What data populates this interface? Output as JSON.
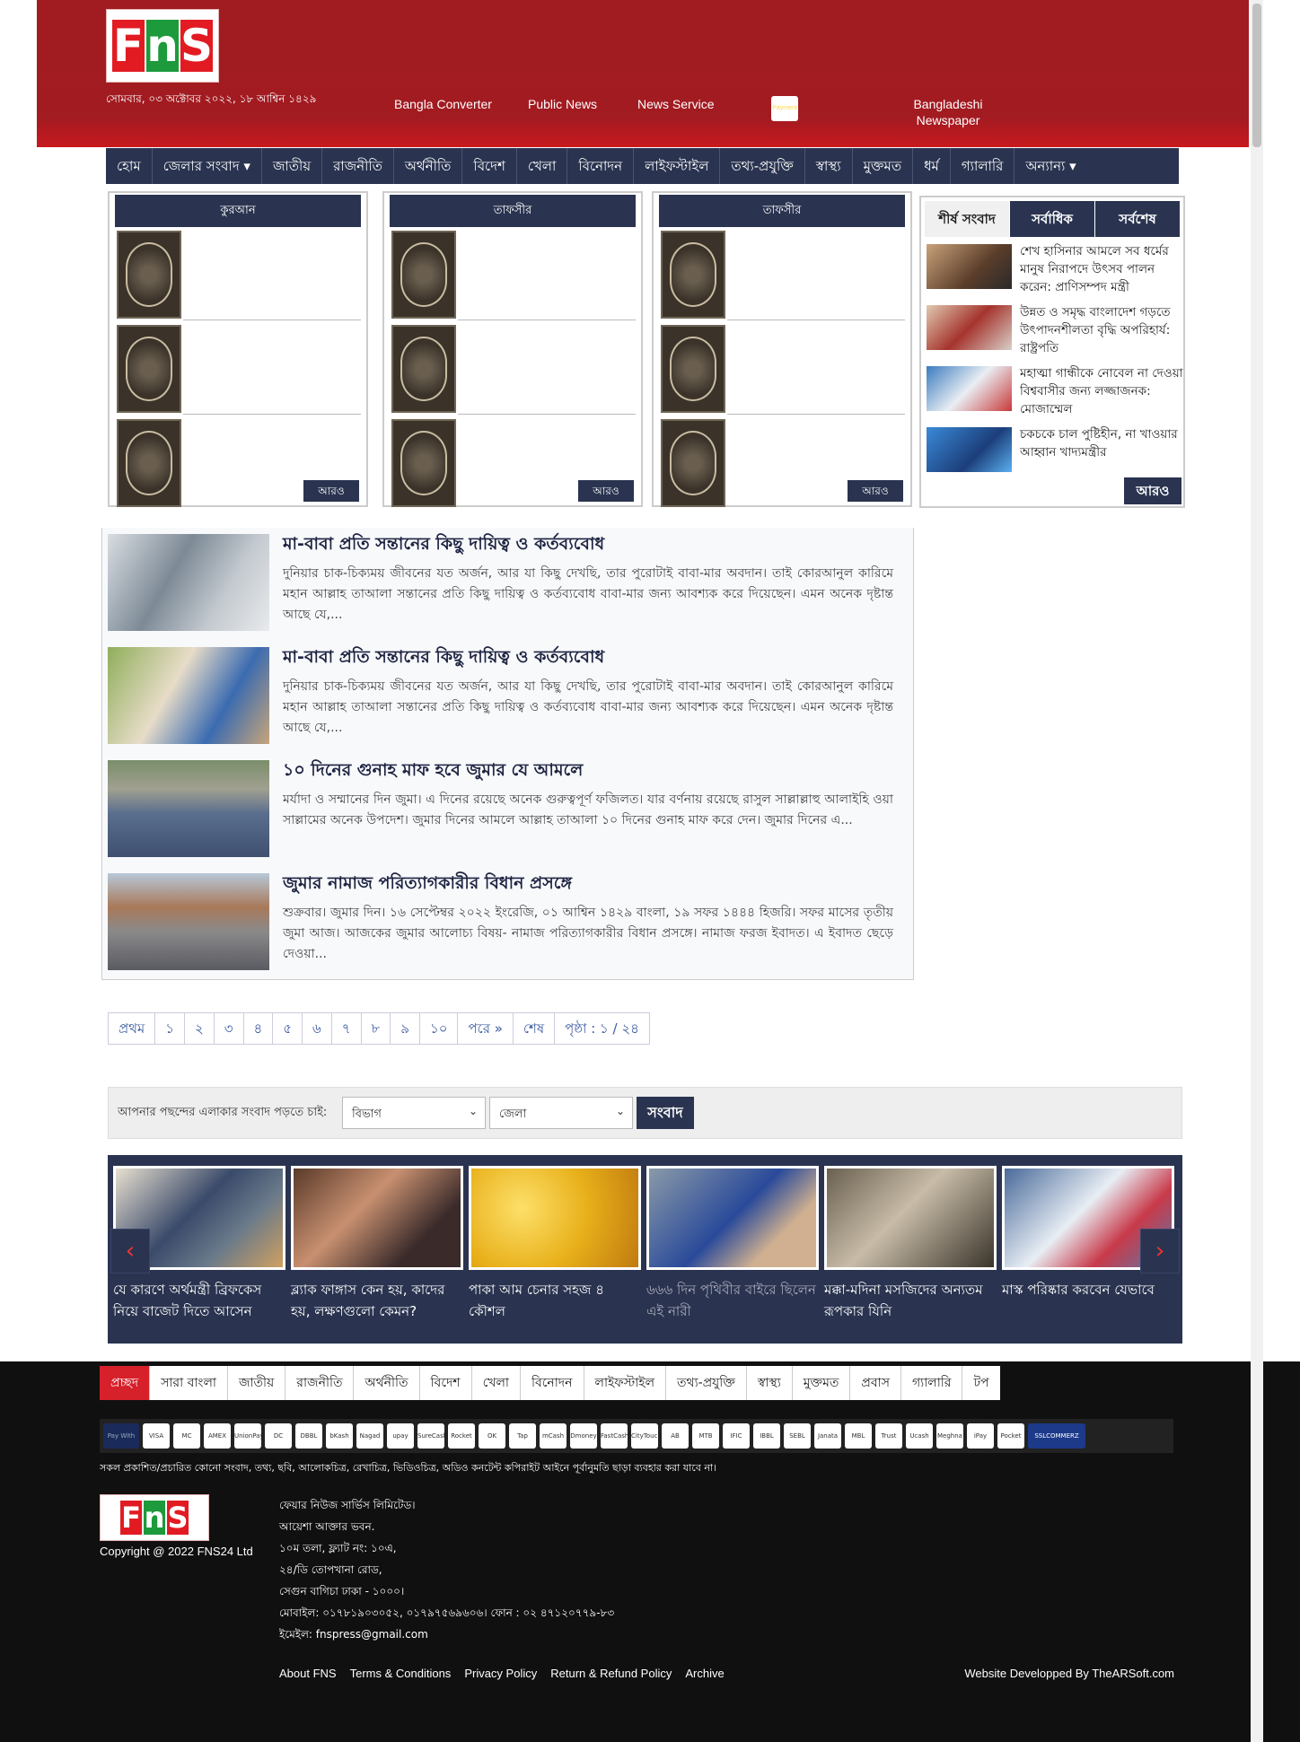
{
  "header": {
    "logo": "FNS",
    "date": "সোমবার, ০৩ অক্টোবর ২০২২, ১৮ আশ্বিন ১৪২৯",
    "links": [
      "Bangla Converter",
      "Public News",
      "News Service",
      "Payment",
      "Bangladeshi Newspaper"
    ]
  },
  "nav": [
    "হোম",
    "জেলার সংবাদ ▾",
    "জাতীয়",
    "রাজনীতি",
    "অর্থনীতি",
    "বিদেশ",
    "খেলা",
    "বিনোদন",
    "লাইফস্টাইল",
    "তথ্য-প্রযুক্তি",
    "স্বাস্থ্য",
    "মুক্তমত",
    "ধর্ম",
    "গ্যালারি",
    "অন্যান্য ▾"
  ],
  "boxes": [
    {
      "title": "কুরআন",
      "more": "আরও"
    },
    {
      "title": "তাফসীর",
      "more": "আরও"
    },
    {
      "title": "তাফসীর",
      "more": "আরও"
    }
  ],
  "sidebar": {
    "tabs": [
      "শীর্ষ সংবাদ",
      "সর্বাধিক",
      "সর্বশেষ"
    ],
    "items": [
      "শেখ হাসিনার আমলে সব ধর্মের মানুষ নিরাপদে উৎসব পালন করেন: প্রাণিসম্পদ মন্ত্রী",
      "উন্নত ও সমৃদ্ধ বাংলাদেশ গড়তে উৎপাদনশীলতা বৃদ্ধি অপরিহার্য: রাষ্ট্রপতি",
      "মহাত্মা গান্ধীকে নোবেল না দেওয়া বিশ্ববাসীর জন্য লজ্জাজনক: মোজাম্মেল",
      "চকচকে চাল পুষ্টিহীন, না খাওয়ার আহ্বান খাদ্যমন্ত্রীর"
    ],
    "more": "আরও"
  },
  "articles": [
    {
      "title": "মা-বাবা প্রতি সন্তানের কিছু দায়িত্ব ও কর্তব্যবোধ",
      "desc": "দুনিয়ার চাক-চিক্যময় জীবনের যত অর্জন, আর যা কিছু দেখছি, তার পুরোটাই বাবা-মার অবদান। তাই কোরআনুল কারিমে মহান আল্লাহ তাআলা সন্তানের প্রতি কিছু দায়িত্ব ও কর্তব্যবোধ বাবা-মার জন্য আবশ্যক করে দিয়েছেন। এমন অনেক দৃষ্টান্ত আছে যে,..."
    },
    {
      "title": "মা-বাবা প্রতি সন্তানের কিছু দায়িত্ব ও কর্তব্যবোধ",
      "desc": "দুনিয়ার চাক-চিক্যময় জীবনের যত অর্জন, আর যা কিছু দেখছি, তার পুরোটাই বাবা-মার অবদান। তাই কোরআনুল কারিমে মহান আল্লাহ তাআলা সন্তানের প্রতি কিছু দায়িত্ব ও কর্তব্যবোধ বাবা-মার জন্য আবশ্যক করে দিয়েছেন। এমন অনেক দৃষ্টান্ত আছে যে,..."
    },
    {
      "title": "১০ দিনের গুনাহ মাফ হবে জুমার যে আমলে",
      "desc": "মর্যাদা ও সম্মানের দিন জুমা। এ দিনের রয়েছে অনেক গুরুত্বপূর্ণ ফজিলত। যার বর্ণনায় রয়েছে রাসুল সাল্লাল্লাহু আলাইহি ওয়া সাল্লামের অনেক উপদেশ। জুমার দিনের আমলে আল্লাহ তাআলা ১০ দিনের গুনাহ মাফ করে দেন। জুমার দিনের এ..."
    },
    {
      "title": "জুমার নামাজ পরিত্যাগকারীর বিধান প্রসঙ্গে",
      "desc": "শুক্রবার। জুমার দিন। ১৬ সেপ্টেম্বর ২০২২ ইংরেজি, ০১ আশ্বিন ১৪২৯ বাংলা, ১৯ সফর ১৪৪৪ হিজরি। সফর মাসের তৃতীয় জুমা আজ। আজকের জুমার আলোচ্য বিষয়- নামাজ পরিত্যাগকারীর বিধান প্রসঙ্গে। নামাজ ফরজ ইবাদত। এ ইবাদত ছেড়ে দেওয়া..."
    }
  ],
  "pager": [
    "প্রথম",
    "১",
    "২",
    "৩",
    "৪",
    "৫",
    "৬",
    "৭",
    "৮",
    "৯",
    "১০",
    "পরে »",
    "শেষ",
    "পৃষ্ঠা : ১ / ২৪"
  ],
  "area": {
    "label": "আপনার পছন্দের এলাকার সংবাদ পড়তে চাই:",
    "division": "বিভাগ",
    "district": "জেলা",
    "button": "সংবাদ"
  },
  "carousel": [
    "যে কারণে অর্থমন্ত্রী ব্রিফকেস নিয়ে বাজেট দিতে আসেন",
    "ব্ল্যাক ফাঙ্গাস কেন হয়, কাদের হয়, লক্ষণগুলো কেমন?",
    "পাকা আম চেনার সহজ ৪ কৌশল",
    "৬৬৬ দিন পৃথিবীর বাইরে ছিলেন এই নারী",
    "মক্কা-মদিনা মসজিদের অন্যতম রূপকার যিনি",
    "মাস্ক পরিষ্কার করবেন যেভাবে"
  ],
  "footer": {
    "nav": [
      "প্রচ্ছদ",
      "সারা বাংলা",
      "জাতীয়",
      "রাজনীতি",
      "অর্থনীতি",
      "বিদেশ",
      "খেলা",
      "বিনোদন",
      "লাইফস্টাইল",
      "তথ্য-প্রযুক্তি",
      "স্বাস্থ্য",
      "মুক্তমত",
      "প্রবাস",
      "গ্যালারি",
      "টপ"
    ],
    "payments": [
      "Pay With",
      "VISA",
      "MC",
      "AMEX",
      "UnionPay",
      "DC",
      "DBBL",
      "bKash",
      "Nagad",
      "upay",
      "SureCash",
      "Rocket",
      "OK",
      "Tap",
      "mCash",
      "Dmoney",
      "FastCash",
      "CityTouch",
      "AB",
      "MTB",
      "IFIC",
      "IBBL",
      "SEBL",
      "Janata",
      "MBL",
      "Trust",
      "Ucash",
      "Meghna",
      "iPay",
      "Pocket",
      "SSLCOMMERZ"
    ],
    "notice": "সকল প্রকাশিত/প্রচারিত কোনো সংবাদ, তথ্য, ছবি, আলোকচিত্র, রেখাচিত্র, ভিডিওচিত্র, অডিও কনটেন্ট কপিরাইট আইনে পূর্বানুমতি ছাড়া ব্যবহার করা যাবে না।",
    "copyright": "Copyright @ 2022 FNS24 Ltd",
    "address": [
      "ফেয়ার নিউজ সার্ভিস লিমিটেড।",
      "আয়েশা আক্তার ভবন.",
      "১০ম তলা, ফ্ল্যাট নং: ১০এ,",
      "২৪/ডি তোপখানা রোড,",
      "সেগুন বাগিচা ঢাকা - ১০০০।",
      "মোবাইল: ০১৭৮১৯০৩০৫২, ০১৭৯৭৫৬৯৬০৬। ফোন : ০২ ৪৭১২০৭৭৯-৮৩",
      "ইমেইল: fnspress@gmail.com"
    ],
    "links": [
      "About FNS",
      "Terms & Conditions",
      "Privacy Policy",
      "Return & Refund Policy",
      "Archive"
    ],
    "developer": "Website Developped By TheARSoft.com"
  }
}
